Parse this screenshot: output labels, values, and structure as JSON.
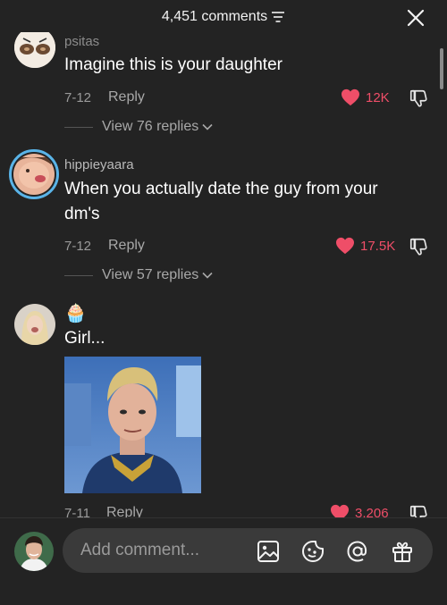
{
  "header": {
    "comment_count": "4,451 comments",
    "sort_icon": "sort-lines-icon",
    "close_icon": "close-x-icon"
  },
  "comments": [
    {
      "username": "psitas",
      "text": "Imagine this is your daughter",
      "date": "7-12",
      "reply_label": "Reply",
      "likes": "12K",
      "view_replies": "View 76 replies"
    },
    {
      "username": "hippieyaara",
      "text_lines": [
        "When you actually date the guy from your",
        "dm's"
      ],
      "date": "7-12",
      "reply_label": "Reply",
      "likes": "17.5K",
      "view_replies": "View 57 replies"
    },
    {
      "username_emoji": "🧁",
      "text": "Girl...",
      "date": "7-11",
      "reply_label": "Reply",
      "likes": "3,206"
    }
  ],
  "composer": {
    "placeholder": "Add comment..."
  },
  "colors": {
    "background": "#232323",
    "like_red": "#ef4e68",
    "muted": "#9a9a9a",
    "input_bg": "#3a3a3a"
  }
}
